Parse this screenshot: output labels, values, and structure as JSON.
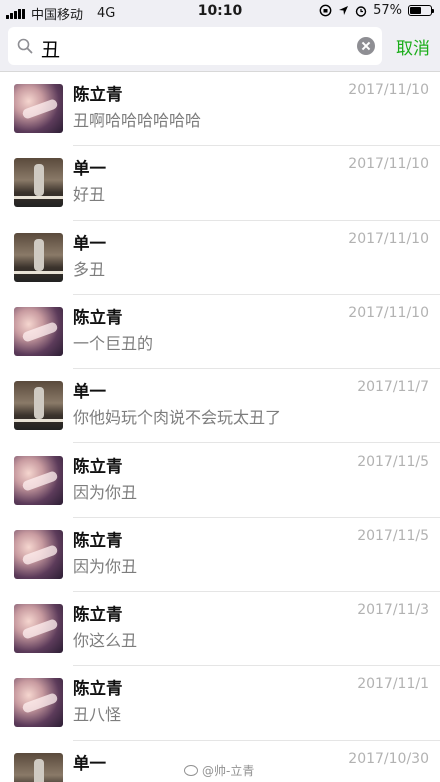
{
  "status_bar": {
    "carrier": "中国移动",
    "network": "4G",
    "time": "10:10",
    "battery_percent": "57%",
    "battery_level": 0.57
  },
  "search": {
    "query": "丑",
    "cancel_label": "取消"
  },
  "results": [
    {
      "name": "陈立青",
      "date": "2017/11/10",
      "snippet": "丑啊哈哈哈哈哈哈",
      "avatar": "chen"
    },
    {
      "name": "单一",
      "date": "2017/11/10",
      "snippet": "好丑",
      "avatar": "shan"
    },
    {
      "name": "单一",
      "date": "2017/11/10",
      "snippet": "多丑",
      "avatar": "shan"
    },
    {
      "name": "陈立青",
      "date": "2017/11/10",
      "snippet": "一个巨丑的",
      "avatar": "chen"
    },
    {
      "name": "单一",
      "date": "2017/11/7",
      "snippet": "你他妈玩个肉说不会玩太丑了",
      "avatar": "shan"
    },
    {
      "name": "陈立青",
      "date": "2017/11/5",
      "snippet": "因为你丑",
      "avatar": "chen"
    },
    {
      "name": "陈立青",
      "date": "2017/11/5",
      "snippet": "因为你丑",
      "avatar": "chen"
    },
    {
      "name": "陈立青",
      "date": "2017/11/3",
      "snippet": "你这么丑",
      "avatar": "chen"
    },
    {
      "name": "陈立青",
      "date": "2017/11/1",
      "snippet": "丑八怪",
      "avatar": "chen"
    },
    {
      "name": "单一",
      "date": "2017/10/30",
      "snippet": "",
      "avatar": "shan"
    }
  ],
  "watermark": {
    "text": "@帅-立青"
  }
}
